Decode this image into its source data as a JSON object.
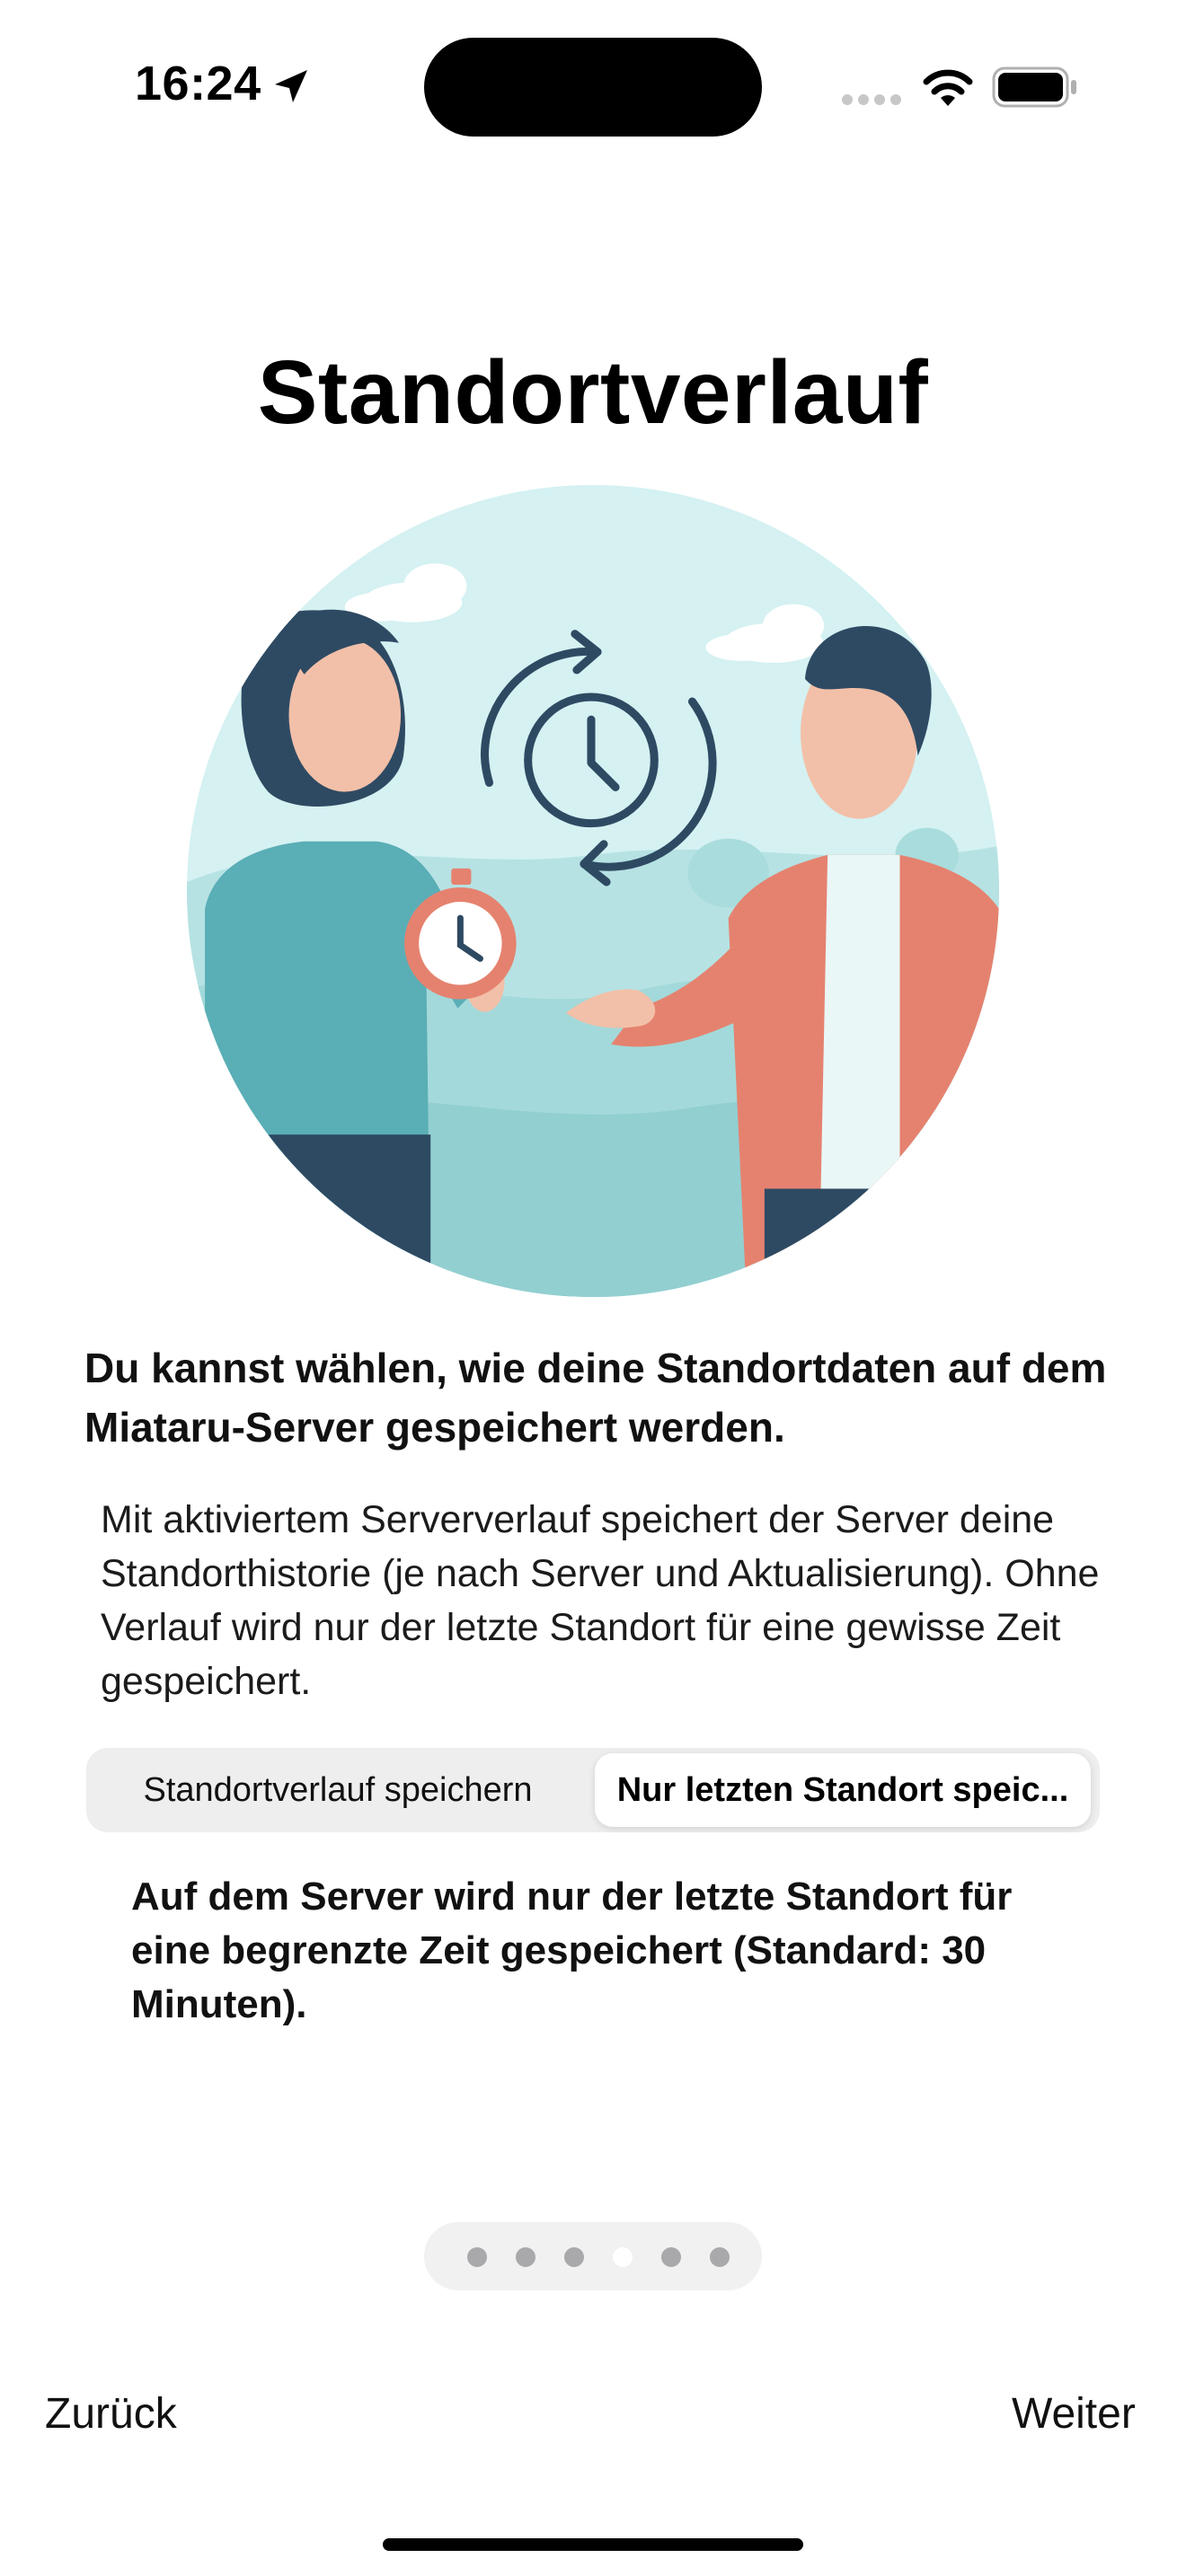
{
  "status_bar": {
    "time": "16:24",
    "icons": [
      "location-arrow-icon",
      "cellular-signal-icon",
      "wifi-icon",
      "battery-icon"
    ]
  },
  "title": "Standortverlauf",
  "headline": "Du kannst wählen, wie deine Standortdaten auf dem Miataru-Server gespeichert werden.",
  "description": "Mit aktiviertem Serververlauf speichert der Server deine Standorthistorie (je nach Server und Aktualisierung). Ohne Verlauf wird nur der letzte Standort für eine gewisse Zeit gespeichert.",
  "segmented_control": {
    "options": [
      "Standortverlauf speichern",
      "Nur letzten Standort speic..."
    ],
    "selected_index": 1
  },
  "mode_description": "Auf dem Server wird nur der letzte Standort für eine begrenzte Zeit gespeichert (Standard: 30 Minuten).",
  "page_indicator": {
    "total": 6,
    "current_index": 3
  },
  "navigation": {
    "back_label": "Zurück",
    "next_label": "Weiter"
  },
  "colors": {
    "illustration_sky": "#d5f1f2",
    "woman_sweater": "#5aaeb6",
    "man_jacket": "#e5826f",
    "clock_stroke": "#2e4a63"
  }
}
